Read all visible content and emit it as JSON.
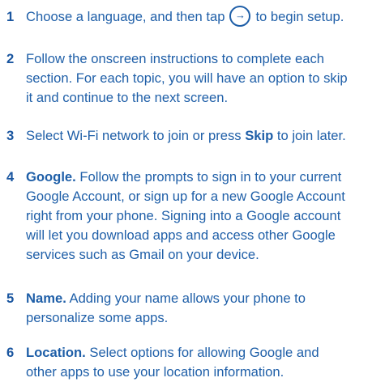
{
  "steps": [
    {
      "number": "1",
      "text_before": "Choose a language, and then tap",
      "icon": "arrow-right-circle-icon",
      "icon_glyph": "→",
      "text_after": "to begin setup."
    },
    {
      "number": "2",
      "lines": [
        "Follow the onscreen instructions to complete each",
        "section. For each topic, you will have an option to skip",
        "it and continue to the next screen."
      ]
    },
    {
      "number": "3",
      "text_before": "Select Wi-Fi network to join or press",
      "bold": "Skip",
      "text_after": "to join later."
    },
    {
      "number": "4",
      "bold": "Google.",
      "lines": [
        "Follow the prompts to sign in to your current",
        "Google Account, or sign up for a new Google Account",
        "right from your phone. Signing into a Google account",
        "will let you download apps and access other Google",
        "services such as Gmail on your device."
      ]
    },
    {
      "number": "5",
      "bold": "Name.",
      "lines": [
        "Adding your name allows your phone to",
        "personalize some apps."
      ]
    },
    {
      "number": "6",
      "bold": "Location.",
      "lines": [
        "Select options for allowing Google and",
        "other apps to use your location information."
      ]
    }
  ]
}
